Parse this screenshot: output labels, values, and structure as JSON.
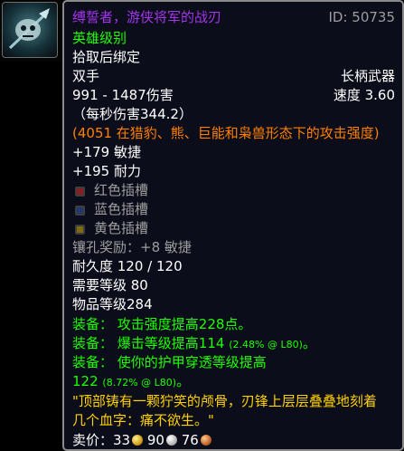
{
  "item": {
    "name": "缚誓者，游侠将军的战刃",
    "id_label": "ID: 50735",
    "quality": "英雄级别",
    "binding": "拾取后绑定",
    "hand": "双手",
    "weapon_type": "长柄武器",
    "damage": "991 - 1487伤害",
    "speed": "速度 3.60",
    "dps": "（每秒伤害344.2）",
    "feral_ap": "(4051 在猎豹、熊、巨能和枭兽形态下的攻击强度)",
    "stat_agility": "+179 敏捷",
    "stat_stamina": "+195 耐力",
    "sockets": [
      {
        "label": "红色插槽",
        "color": "#c0392b"
      },
      {
        "label": "蓝色插槽",
        "color": "#2f4f9f"
      },
      {
        "label": "黄色插槽",
        "color": "#c8a51f"
      }
    ],
    "socket_bonus": "镶孔奖励：+8 敏捷",
    "durability": "耐久度 120 / 120",
    "required_level": "需要等级 80",
    "item_level": "物品等级284",
    "equip": [
      {
        "prefix": "装备：",
        "text": "攻击强度提高228点。",
        "note": ""
      },
      {
        "prefix": "装备：",
        "text": "爆击等级提高114",
        "note": "(2.48% @ L80)",
        "suffix": "。"
      },
      {
        "prefix": "装备：",
        "text": "使你的护甲穿透等级提高",
        "note": ""
      }
    ],
    "equip3_cont": "122",
    "equip3_note": "(8.72% @ L80)",
    "equip3_suffix": "。",
    "flavor_line1": "\"顶部铸有一颗狞笑的颅骨，刃锋上层层叠叠地刻着",
    "flavor_line2": "几个血字：痛不欲生。\"",
    "sell": {
      "label": "卖价：",
      "gold": "33",
      "silver": "90",
      "copper": "76"
    }
  },
  "colors": {
    "epic": "#a335ee",
    "green": "#1eff00",
    "orange": "#ff8000",
    "flavor": "#ffd100",
    "gray": "#9d9d9d"
  },
  "icon": "skull-polearm-icon"
}
